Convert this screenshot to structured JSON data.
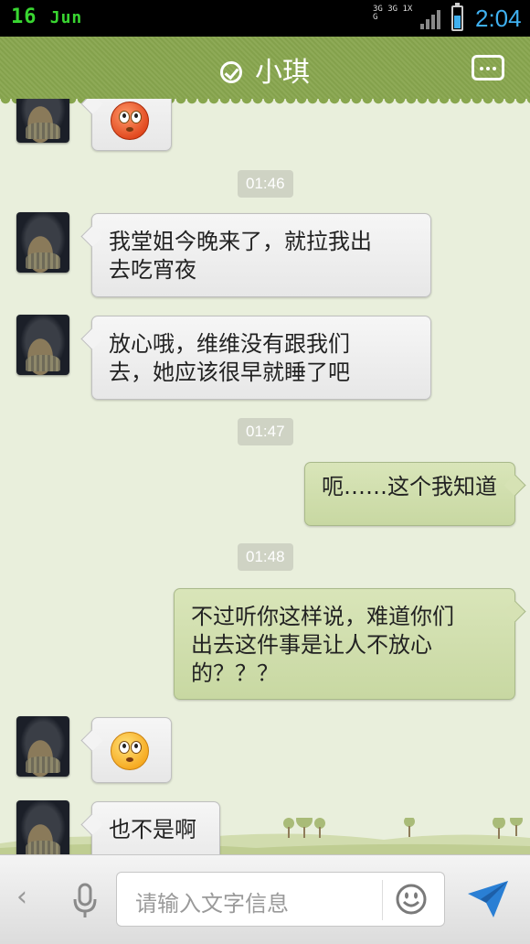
{
  "status_bar": {
    "day": "16",
    "month": "Jun",
    "network": "3G 3G 1X G",
    "time": "2:04"
  },
  "header": {
    "title": "小琪",
    "check_icon": "check-circle-icon",
    "menu_icon": "more-dots-icon"
  },
  "chat": {
    "timestamps": [
      "01:46",
      "01:47",
      "01:48"
    ],
    "messages": [
      {
        "from": "contact",
        "type": "emoji",
        "emoji": "rolling-eyes-red-emoji"
      },
      {
        "from": "contact",
        "type": "text",
        "line1": "我堂姐今晚来了，就拉我出",
        "line2": "去吃宵夜"
      },
      {
        "from": "contact",
        "type": "text",
        "line1": "放心哦，维维没有跟我们",
        "line2": "去，她应该很早就睡了吧"
      },
      {
        "from": "me",
        "type": "text",
        "text": "呃……这个我知道"
      },
      {
        "from": "me",
        "type": "text",
        "line1": "不过听你这样说，难道你们",
        "line2": "出去这件事是让人不放心",
        "line3": "的？？？"
      },
      {
        "from": "contact",
        "type": "emoji",
        "emoji": "rolling-eyes-yellow-emoji"
      },
      {
        "from": "contact",
        "type": "text",
        "text": "也不是啊"
      }
    ]
  },
  "input_bar": {
    "placeholder": "请输入文字信息"
  },
  "colors": {
    "header_bg": "#88a64e",
    "outgoing_bubble": "#d0ddad",
    "incoming_bubble": "#efefef",
    "chat_bg": "#e9efdc"
  }
}
